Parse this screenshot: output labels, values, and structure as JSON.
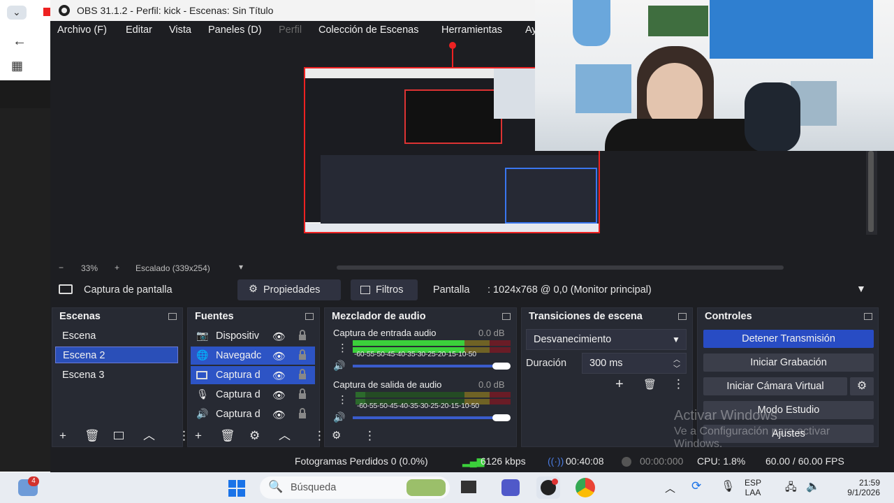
{
  "window": {
    "title": "OBS 31.1.2 - Perfil: kick - Escenas: Sin Título"
  },
  "menu": [
    {
      "label": "Archivo (F)",
      "disabled": false
    },
    {
      "label": "Editar",
      "disabled": false
    },
    {
      "label": "Vista",
      "disabled": false
    },
    {
      "label": "Paneles (D)",
      "disabled": false
    },
    {
      "label": "Perfil",
      "disabled": true
    },
    {
      "label": "Colección de Escenas",
      "disabled": false
    },
    {
      "label": "Herramientas",
      "disabled": false
    },
    {
      "label": "Ay",
      "disabled": false
    }
  ],
  "preview": {
    "zoom": "33%",
    "scale_label": "Escalado (339x254)"
  },
  "source_bar": {
    "source_name": "Captura de pantalla",
    "properties_label": "Propiedades",
    "filters_label": "Filtros",
    "display_label": "Pantalla",
    "display_value": ": 1024x768 @ 0,0 (Monitor principal)"
  },
  "scenes": {
    "title": "Escenas",
    "items": [
      "Escena",
      "Escena 2",
      "Escena 3"
    ],
    "selected": "Escena 2"
  },
  "sources": {
    "title": "Fuentes",
    "items": [
      {
        "name": "Dispositiv",
        "icon": "camera-icon"
      },
      {
        "name": "Navegadc",
        "icon": "globe-icon"
      },
      {
        "name": "Captura d",
        "icon": "monitor-icon"
      },
      {
        "name": "Captura d",
        "icon": "microphone-icon"
      },
      {
        "name": "Captura d",
        "icon": "speaker-icon"
      }
    ]
  },
  "mixer": {
    "title": "Mezclador de audio",
    "channels": [
      {
        "name": "Captura de entrada audio",
        "db": "0.0 dB",
        "level": 0.82,
        "volume": 1.0
      },
      {
        "name": "Captura de salida de audio",
        "db": "0.0 dB",
        "level": 0.82,
        "volume": 1.0
      }
    ],
    "tick_labels": [
      "-60",
      "-55",
      "-50",
      "-45",
      "-40",
      "-35",
      "-30",
      "-25",
      "-20",
      "-15",
      "-10",
      "-5",
      "0"
    ]
  },
  "transitions": {
    "title": "Transiciones de escena",
    "selected": "Desvanecimiento",
    "duration_label": "Duración",
    "duration_value": "300 ms"
  },
  "controls": {
    "title": "Controles",
    "stop_stream": "Detener Transmisión",
    "start_recording": "Iniciar Grabación",
    "start_virtual_cam": "Iniciar Cámara Virtual",
    "studio_mode": "Modo Estudio",
    "settings": "Ajustes"
  },
  "status": {
    "dropped_frames": "Fotogramas Perdidos 0 (0.0%)",
    "bitrate": "6126 kbps",
    "stream_time": "00:40:08",
    "record_time": "00:00:000",
    "cpu": "CPU: 1.8%",
    "fps": "60.00 / 60.00 FPS"
  },
  "watermark": {
    "line1": "Activar Windows",
    "line2": "Ve a Configuración para activar",
    "line3": "Windows."
  },
  "taskbar": {
    "search_placeholder": "Búsqueda",
    "badge_count": "4",
    "lang": "ESP",
    "lang2": "LAA",
    "time": "21:59",
    "date": "9/1/2026"
  },
  "colors": {
    "obs_bg": "#1d1e22",
    "dock_bg": "#272a33",
    "accent": "#284cc4",
    "meter_green": "#3bd03b"
  }
}
